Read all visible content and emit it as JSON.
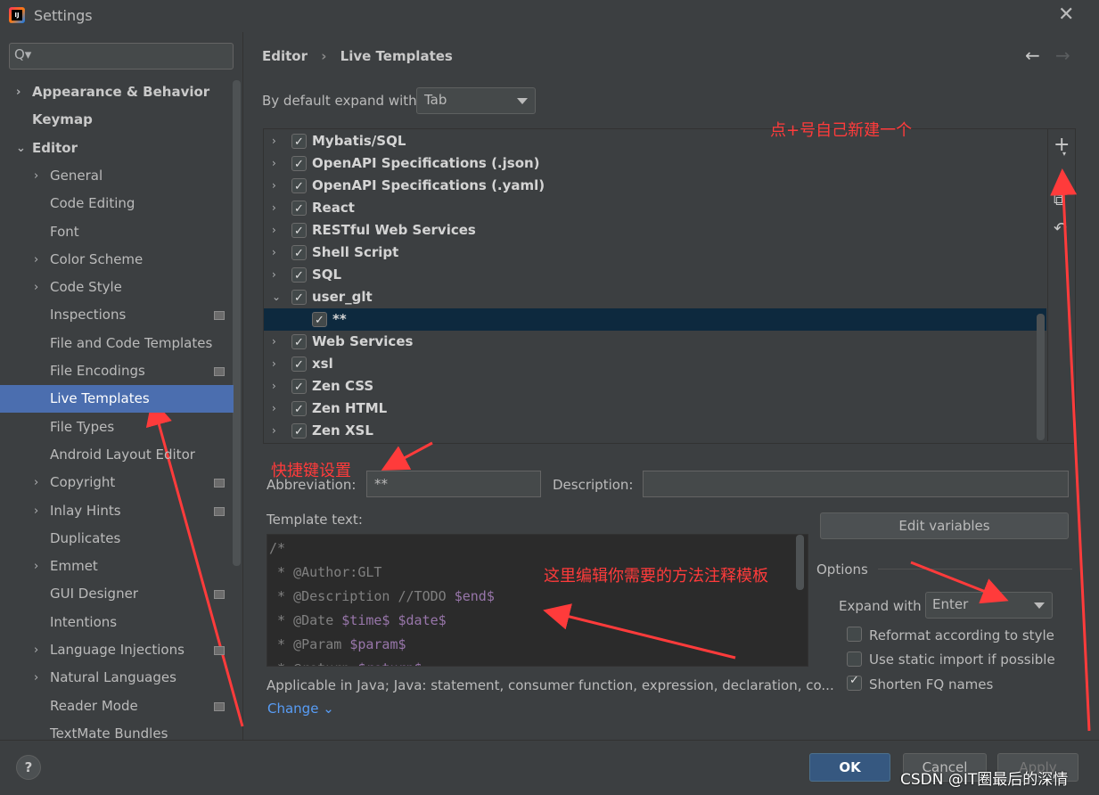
{
  "window": {
    "title": "Settings",
    "icon_text": "IJ",
    "close": "✕"
  },
  "search": {
    "placeholder": "",
    "icon": "Q▾"
  },
  "sidebar": {
    "items": [
      {
        "label": "Appearance & Behavior",
        "chevron": "›",
        "bold": true
      },
      {
        "label": "Keymap",
        "bold": true
      },
      {
        "label": "Editor",
        "chevron": "⌄",
        "bold": true
      },
      {
        "label": "General",
        "chevron": "›"
      },
      {
        "label": "Code Editing"
      },
      {
        "label": "Font"
      },
      {
        "label": "Color Scheme",
        "chevron": "›"
      },
      {
        "label": "Code Style",
        "chevron": "›"
      },
      {
        "label": "Inspections",
        "badge": true
      },
      {
        "label": "File and Code Templates"
      },
      {
        "label": "File Encodings",
        "badge": true
      },
      {
        "label": "Live Templates",
        "selected": true
      },
      {
        "label": "File Types"
      },
      {
        "label": "Android Layout Editor"
      },
      {
        "label": "Copyright",
        "chevron": "›",
        "badge": true
      },
      {
        "label": "Inlay Hints",
        "chevron": "›",
        "badge": true
      },
      {
        "label": "Duplicates"
      },
      {
        "label": "Emmet",
        "chevron": "›"
      },
      {
        "label": "GUI Designer",
        "badge": true
      },
      {
        "label": "Intentions"
      },
      {
        "label": "Language Injections",
        "chevron": "›",
        "badge": true
      },
      {
        "label": "Natural Languages",
        "chevron": "›"
      },
      {
        "label": "Reader Mode",
        "badge": true
      },
      {
        "label": "TextMate Bundles"
      }
    ]
  },
  "breadcrumb": {
    "parent": "Editor",
    "sep": "›",
    "current": "Live Templates"
  },
  "nav": {
    "back": "←",
    "forward": "→"
  },
  "expand_default": {
    "label": "By default expand with",
    "value": "Tab"
  },
  "template_groups": [
    {
      "name": "Mybatis/SQL",
      "chevron": "›"
    },
    {
      "name": "OpenAPI Specifications (.json)",
      "chevron": "›"
    },
    {
      "name": "OpenAPI Specifications (.yaml)",
      "chevron": "›"
    },
    {
      "name": "React",
      "chevron": "›"
    },
    {
      "name": "RESTful Web Services",
      "chevron": "›"
    },
    {
      "name": "Shell Script",
      "chevron": "›"
    },
    {
      "name": "SQL",
      "chevron": "›"
    },
    {
      "name": "user_glt",
      "chevron": "⌄"
    },
    {
      "name": "**",
      "child": true,
      "selected": true
    },
    {
      "name": "Web Services",
      "chevron": "›"
    },
    {
      "name": "xsl",
      "chevron": "›"
    },
    {
      "name": "Zen CSS",
      "chevron": "›"
    },
    {
      "name": "Zen HTML",
      "chevron": "›"
    },
    {
      "name": "Zen XSL",
      "chevron": "›"
    }
  ],
  "toolbar": {
    "add": "+",
    "add_arrow": "▾",
    "copy": "⧉",
    "restore": "↶"
  },
  "form": {
    "abbreviation_label": "Abbreviation:",
    "abbreviation_value": "**",
    "description_label": "Description:",
    "description_value": "",
    "template_text_label": "Template text:",
    "edit_variables": "Edit variables",
    "applicable": "Applicable in Java; Java: statement, consumer function, expression, declaration, co...",
    "change": "Change ⌄"
  },
  "template_code": [
    {
      "text": "/*"
    },
    {
      "text": " * @Author:GLT"
    },
    {
      "text": " * @Description //TODO ",
      "var": "$end$"
    },
    {
      "text": " * @Date ",
      "var": "$time$ $date$"
    },
    {
      "text": " * @Param ",
      "var": "$param$"
    },
    {
      "text": " * @return ",
      "var": "$return$"
    }
  ],
  "options": {
    "title": "Options",
    "expand_label": "Expand with",
    "expand_value": "Enter",
    "reformat": "Reformat according to style",
    "static_import": "Use static import if possible",
    "shorten_fq": "Shorten FQ names",
    "reformat_checked": false,
    "static_import_checked": false,
    "shorten_fq_checked": true
  },
  "footer": {
    "help": "?",
    "ok": "OK",
    "cancel": "Cancel",
    "apply": "Apply"
  },
  "annotations": {
    "add_hint": "点+号自己新建一个",
    "shortcut_hint": "快捷键设置",
    "edit_hint": "这里编辑你需要的方法注释模板",
    "watermark": "CSDN @IT圈最后的深情"
  },
  "colors": {
    "accent": "#4b6eaf",
    "annotation": "#ff3b3b",
    "link": "#589df6",
    "ok_button": "#365880"
  }
}
